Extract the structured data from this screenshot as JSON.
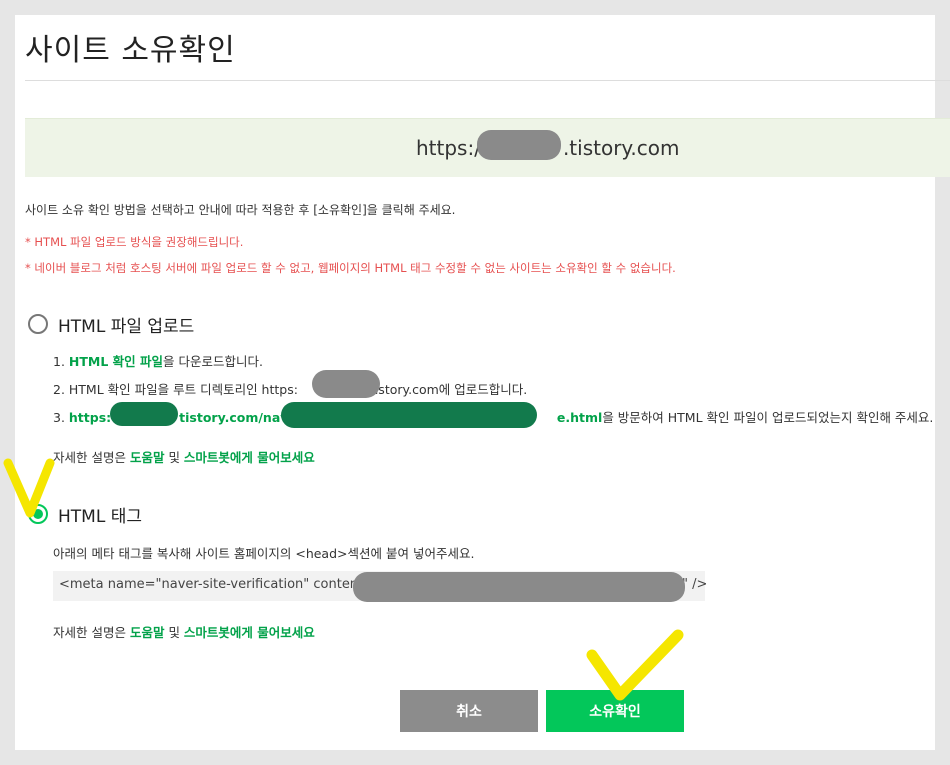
{
  "dialog": {
    "title": "사이트 소유확인",
    "site_url_suffix": ".tistory.com",
    "site_url_prefix": "https:/",
    "intro": "사이트 소유 확인 방법을 선택하고 안내에 따라 적용한 후 [소유확인]을 클릭해 주세요.",
    "notes": [
      "* HTML 파일 업로드 방식을 권장해드립니다.",
      "* 네이버 블로그 처럼 호스팅 서버에 파일 업로드 할 수 없고, 웹페이지의 HTML 태그 수정할 수 없는 사이트는 소유확인 할 수 없습니다."
    ]
  },
  "option_file": {
    "label": "HTML 파일 업로드",
    "step1_prefix": "1. ",
    "step1_link": "HTML 확인 파일",
    "step1_rest": "을 다운로드합니다.",
    "step2_prefix": "2. HTML 확인 파일을 루트 디렉토리인 https:",
    "step2_suffix": "tistory.com에 업로드합니다.",
    "step3_prefix": "3. ",
    "step3_link_a": "https:",
    "step3_link_b": "tistory.com/nave",
    "step3_link_c": "e.html",
    "step3_rest": "을 방문하여 HTML 확인 파일이 업로드되었는지 확인해 주세요.",
    "help_prefix": "자세한 설명은 ",
    "help_link1": "도움말",
    "help_mid": " 및 ",
    "help_link2": "스마트봇에게 물어보세요"
  },
  "option_tag": {
    "label": "HTML 태그",
    "description": "아래의 메타 태그를 복사해 사이트 홈페이지의 <head>섹션에 붙여 넣어주세요.",
    "meta_text": "<meta name=\"naver-site-verification\" content",
    "meta_end": "\" />",
    "help_prefix": "자세한 설명은 ",
    "help_link1": "도움말",
    "help_mid": " 및 ",
    "help_link2": "스마트봇에게 물어보세요"
  },
  "buttons": {
    "cancel": "취소",
    "confirm": "소유확인"
  },
  "colors": {
    "accent": "#03c75a",
    "link": "#03a24a",
    "warning": "#e65050",
    "highlight": "#f5e600"
  }
}
